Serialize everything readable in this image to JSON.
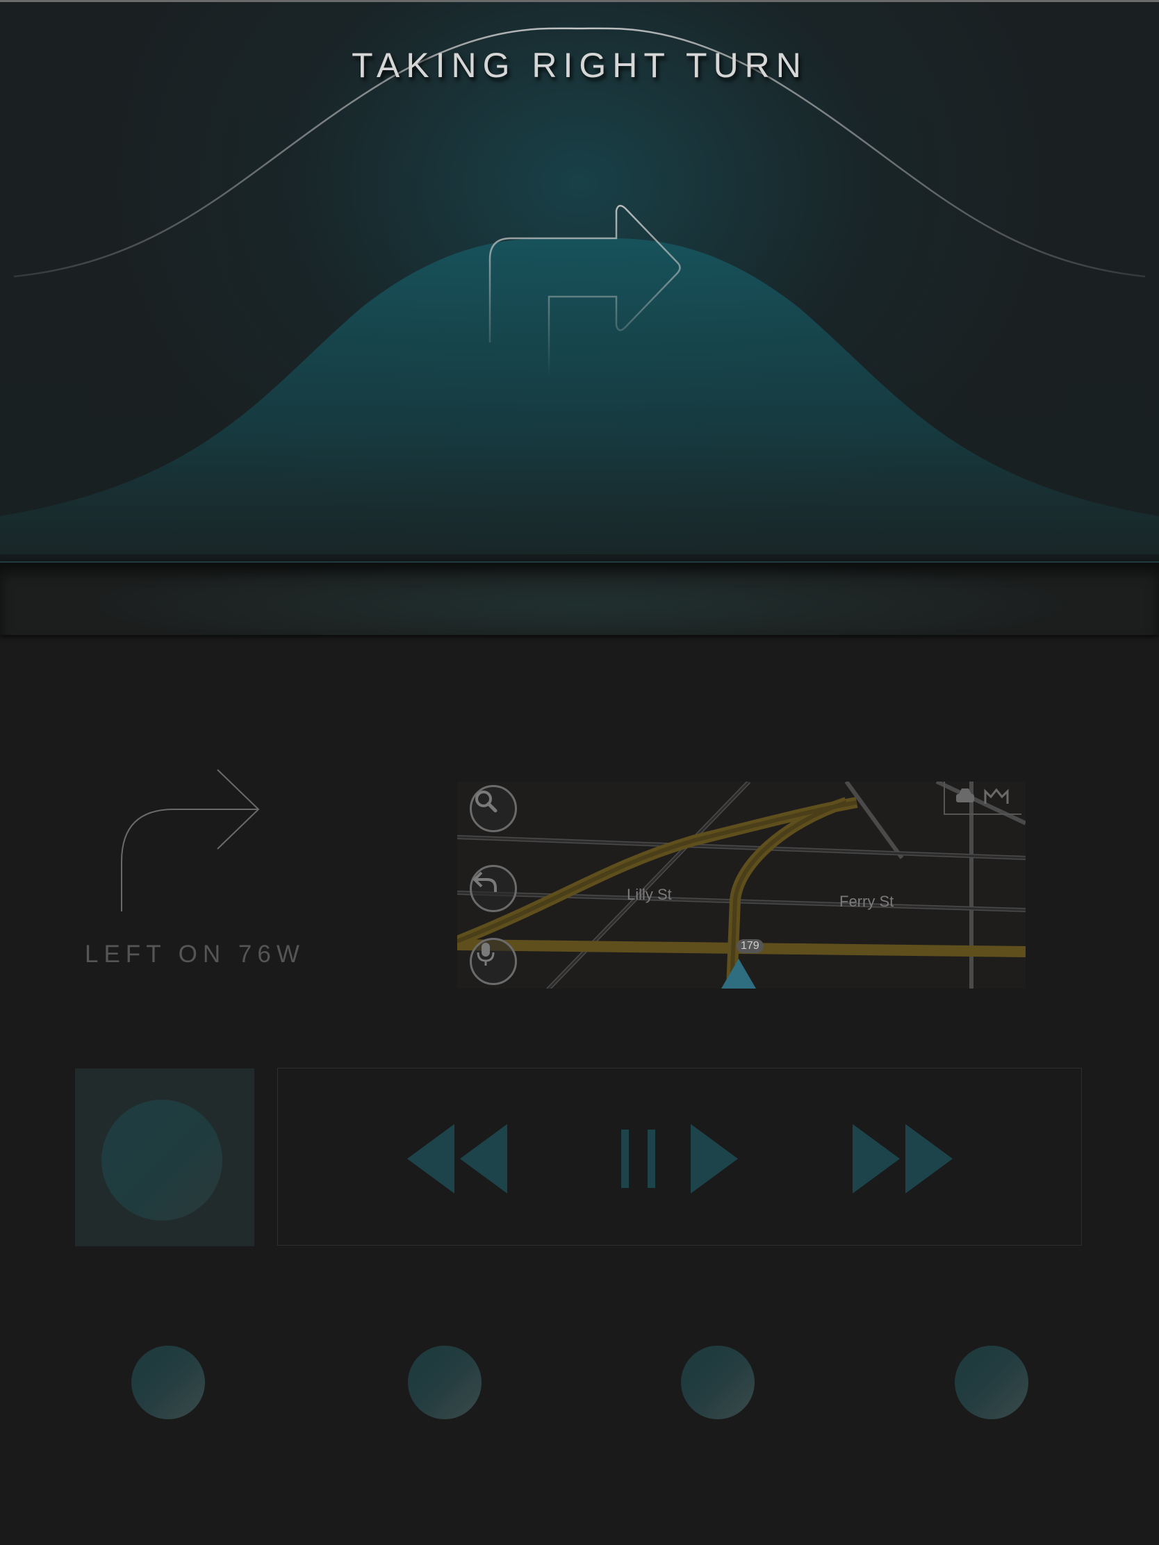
{
  "hero": {
    "title": "TAKING RIGHT TURN",
    "maneuver_icon": "right-turn-arrow-icon"
  },
  "next_turn": {
    "label": "LEFT ON 76W",
    "icon": "curved-right-arrow-icon"
  },
  "map": {
    "streets": [
      "Lilly St",
      "Ferry St"
    ],
    "route_badge": "179",
    "buttons": [
      "search-icon",
      "back-icon",
      "microphone-icon"
    ],
    "top_icons": [
      "car-icon",
      "route-icon"
    ]
  },
  "media": {
    "controls": [
      "rewind-icon",
      "play-pause-icon",
      "fast-forward-icon"
    ]
  },
  "colors": {
    "accent": "#1f4a50",
    "background": "#1a1a1a",
    "road": "#6b5a1f"
  },
  "shortcuts": [
    "shortcut-1",
    "shortcut-2",
    "shortcut-3",
    "shortcut-4"
  ]
}
